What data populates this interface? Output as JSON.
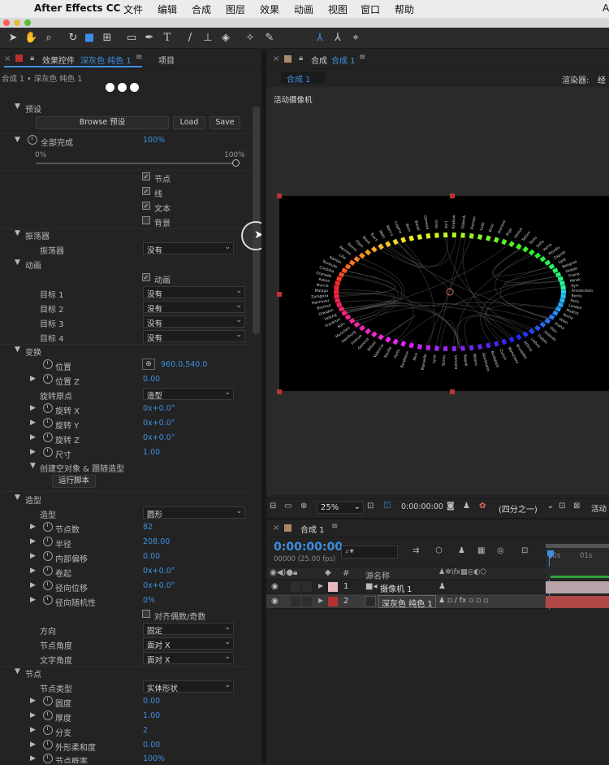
{
  "menubar": {
    "app": "After Effects CC",
    "items": [
      "文件",
      "编辑",
      "合成",
      "图层",
      "效果",
      "动画",
      "视图",
      "窗口",
      "帮助"
    ],
    "right": "A"
  },
  "effects_panel": {
    "tab_prefix": "效果控件",
    "tab_layer": "深灰色 纯色 1",
    "tab_project": "项目",
    "breadcrumb": "合成 1 • 深灰色 纯色 1",
    "presets_label": "预设",
    "browse_label": "Browse 预设",
    "load_label": "Load",
    "save_label": "Save",
    "complete_label": "全部完成",
    "complete_value": "100%",
    "slider_min": "0%",
    "slider_max": "100%",
    "slider_value_pct": 100,
    "checks": [
      {
        "label": "节点",
        "checked": true
      },
      {
        "label": "线",
        "checked": true
      },
      {
        "label": "文本",
        "checked": true
      },
      {
        "label": "背景",
        "checked": false
      }
    ],
    "oscillator_group": "振荡器",
    "oscillator_label": "振荡器",
    "oscillator_value": "没有",
    "anim_group": "动画",
    "anim_check": "动画",
    "targets": [
      {
        "label": "目标 1",
        "value": "没有"
      },
      {
        "label": "目标 2",
        "value": "没有"
      },
      {
        "label": "目标 3",
        "value": "没有"
      },
      {
        "label": "目标 4",
        "value": "没有"
      }
    ],
    "transform_group": "变换",
    "position_label": "位置",
    "position_value": "960.0,540.0",
    "position_z_label": "位置 Z",
    "position_z_value": "0.00",
    "rot_origin_label": "旋转原点",
    "rot_origin_value": "造型",
    "rot_x_label": "旋转 X",
    "rot_x_value": "0x+0.0°",
    "rot_y_label": "旋转 Y",
    "rot_y_value": "0x+0.0°",
    "rot_z_label": "旋转 Z",
    "rot_z_value": "0x+0.0°",
    "size_label": "尺寸",
    "size_value": "1.00",
    "null_group": "创建空对象 & 跟随造型",
    "run_script": "运行脚本",
    "shape_group": "造型",
    "shape_label": "造型",
    "shape_value": "圆形",
    "node_count_label": "节点数",
    "node_count_value": "82",
    "radius_label": "半径",
    "radius_value": "208.00",
    "inner_offset_label": "内部偏移",
    "inner_offset_value": "0.00",
    "curl_label": "卷起",
    "curl_value": "0x+0.0°",
    "radial_pos_label": "径向位移",
    "radial_pos_value": "0x+0.0°",
    "radial_rand_label": "径向随机性",
    "radial_rand_value": "0%",
    "align_check": "对齐偶数/奇数",
    "direction_label": "方向",
    "direction_value": "固定",
    "node_angle_label": "节点角度",
    "node_angle_value": "面对 X",
    "text_angle_label": "文字角度",
    "text_angle_value": "面对 X",
    "node_group": "节点",
    "node_type_label": "节点类型",
    "node_type_value": "实体形状",
    "roundness_label": "圆度",
    "roundness_value": "0.00",
    "thickness_label": "厚度",
    "thickness_value": "1.00",
    "branch_label": "分支",
    "branch_value": "2",
    "feather_label": "外形柔和度",
    "feather_value": "0.00",
    "node_prob_label": "节点概率",
    "node_prob_value": "100%"
  },
  "comp_panel": {
    "tab_prefix": "合成",
    "tab_name": "合成 1",
    "subtab": "合成 1",
    "renderer_label": "渲染器:",
    "renderer_value": "经",
    "camera_label": "活动摄像机",
    "zoom": "25%",
    "timecode": "0:00:00:00",
    "resolution": "(四分之一)",
    "view": "活动"
  },
  "timeline": {
    "tab": "合成 1",
    "timecode": "0:00:00:00",
    "frames": "00000 (25.00 fps)",
    "col_name": "源名称",
    "col_num": "#",
    "ruler": [
      "00s",
      "01s"
    ],
    "layers": [
      {
        "num": "1",
        "name": "摄像机 1",
        "color": "#e8b8c0"
      },
      {
        "num": "2",
        "name": "深灰色 纯色 1",
        "color": "#b83030"
      }
    ]
  },
  "ring_labels": [
    "Amsterdam",
    "Berlin",
    "Paris",
    "London",
    "Madrid",
    "Roma",
    "Wien",
    "Praha",
    "Oslo",
    "Helsinki",
    "Dublin",
    "Lisboa",
    "Athina",
    "Bruxelles",
    "Warszawa",
    "Zurich",
    "Budapest",
    "Stockholm",
    "Milano",
    "Napoli",
    "Venezia",
    "Torino",
    "Lyon",
    "Marseille",
    "Nice",
    "Bordeaux",
    "Porto",
    "Sevilla",
    "Valencia",
    "Bilbao",
    "Genova",
    "Firenze",
    "Hamburg",
    "Munchen",
    "Koln",
    "Frankfurt",
    "Leipzig",
    "Dresden",
    "Bremen",
    "Hannover",
    "Zaragoza",
    "Malaga",
    "Murcia",
    "Palma",
    "Granada",
    "Cordoba",
    "Toulouse",
    "Nantes",
    "Lille",
    "Rennes",
    "Reims",
    "Dijon",
    "Brest",
    "Tours",
    "Metz",
    "Nancy",
    "Lugano",
    "Bern",
    "Basel",
    "Geneve",
    "Graz",
    "Linz",
    "Krakow",
    "Gdansk",
    "Poznan",
    "Lodz",
    "Brno",
    "Ostrava",
    "Riga",
    "Vilnius",
    "Tallinn",
    "Tartu",
    "Sofia",
    "Varna",
    "Plovdiv",
    "Zagreb",
    "Split",
    "Beograd",
    "Skopje",
    "Tirana",
    "Minsk",
    "Kyiv"
  ]
}
